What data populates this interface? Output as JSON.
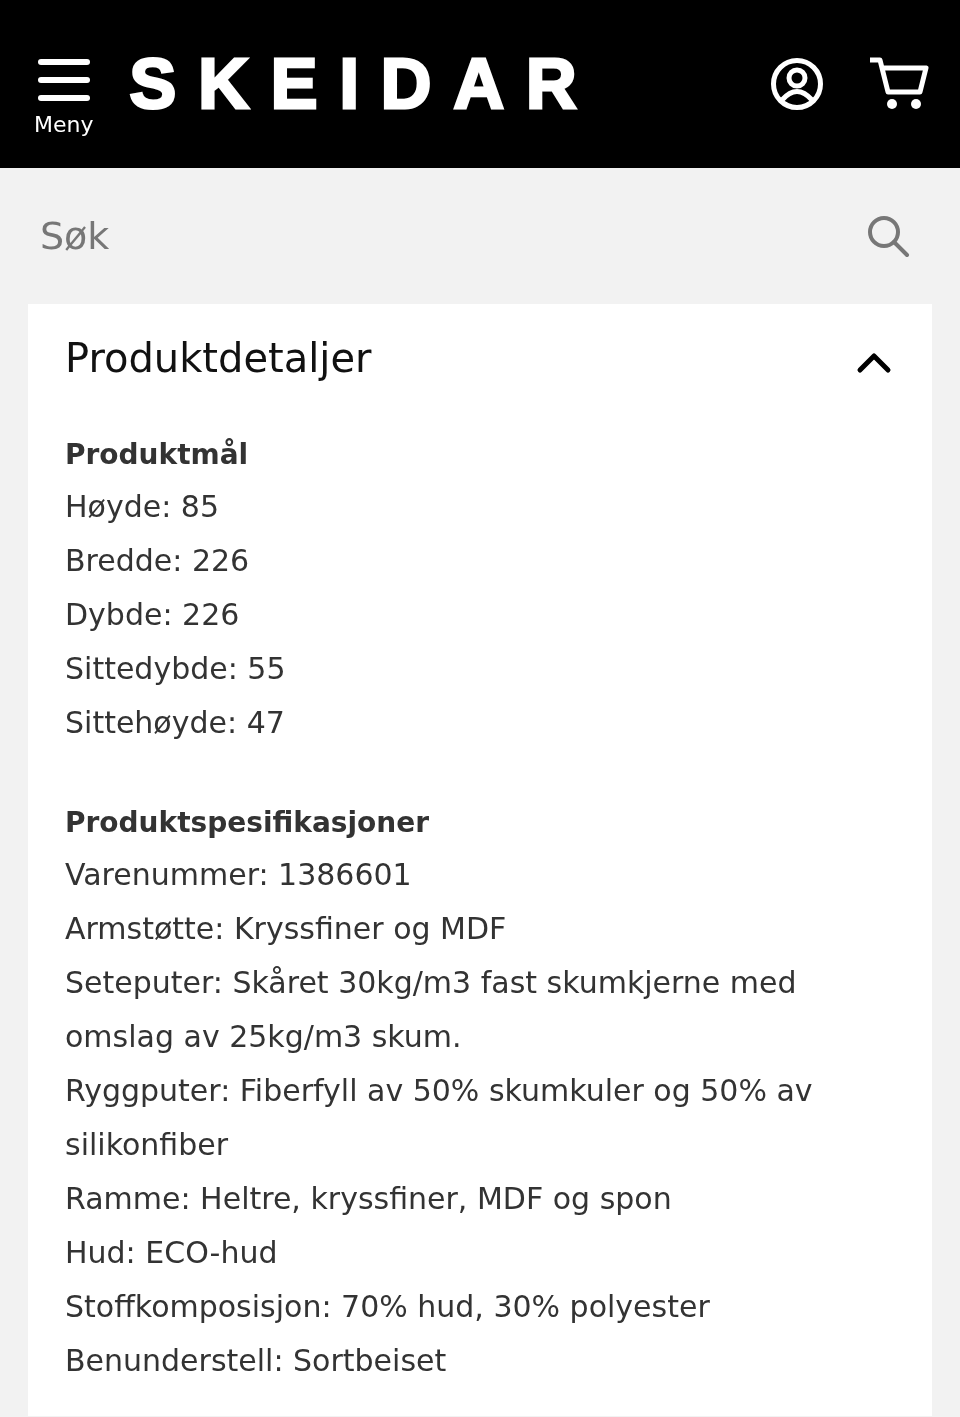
{
  "header": {
    "menu_label": "Meny",
    "logo": "SKEIDAR"
  },
  "search": {
    "placeholder": "Søk"
  },
  "panel": {
    "title": "Produktdetaljer",
    "expanded": true,
    "sections": [
      {
        "heading": "Produktmål",
        "lines": [
          "Høyde: 85",
          "Bredde: 226",
          "Dybde: 226",
          "Sittedybde: 55",
          "Sittehøyde: 47"
        ]
      },
      {
        "heading": "Produktspesifikasjoner",
        "lines": [
          "Varenummer: 1386601",
          "Armstøtte: Kryssfiner og MDF",
          "Seteputer: Skåret 30kg/m3 fast skumkjerne med omslag av 25kg/m3 skum.",
          "Ryggputer: Fiberfyll av 50% skumkuler og 50% av silikonfiber",
          "Ramme: Heltre, kryssfiner, MDF og spon",
          "Hud: ECO-hud",
          "Stoffkomposisjon: 70% hud, 30% polyester",
          "Benunderstell: Sortbeiset"
        ]
      }
    ]
  }
}
